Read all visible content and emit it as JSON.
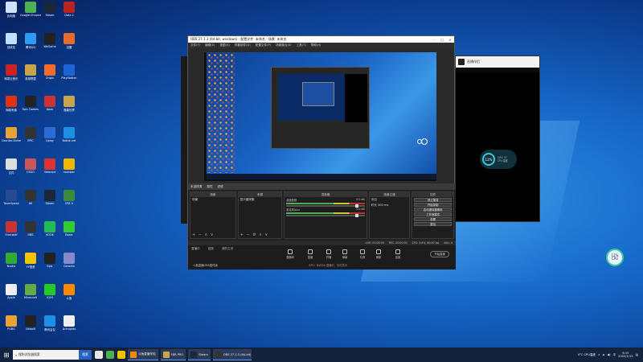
{
  "colors": {
    "desktop": "#1668c9",
    "taskbar": "#14233d",
    "obs_bg": "#2a2a2a",
    "accent": "#3ec7e0"
  },
  "desktop_icons": [
    {
      "label": "此电脑",
      "color": "#cfe3ff"
    },
    {
      "label": "Google Chrome",
      "color": "#4caf50"
    },
    {
      "label": "Steam",
      "color": "#1b2838"
    },
    {
      "label": "Dota 2",
      "color": "#b22"
    },
    {
      "label": "回收站",
      "color": "#bfe0ff"
    },
    {
      "label": "腾讯QQ",
      "color": "#2b9bf4"
    },
    {
      "label": "WeGame",
      "color": "#222"
    },
    {
      "label": "迅雷",
      "color": "#e86b2c"
    },
    {
      "label": "网易云音乐",
      "color": "#c22"
    },
    {
      "label": "英雄联盟",
      "color": "#c9a449"
    },
    {
      "label": "Origin",
      "color": "#f56c2d"
    },
    {
      "label": "PlayStation",
      "color": "#1e63d6"
    },
    {
      "label": "网易有道",
      "color": "#d31"
    },
    {
      "label": "Epic Games",
      "color": "#222"
    },
    {
      "label": "Apex",
      "color": "#c33"
    },
    {
      "label": "魔兽世界",
      "color": "#c9a449"
    },
    {
      "label": "Counter-Strike",
      "color": "#e8a338"
    },
    {
      "label": "EPIC",
      "color": "#333"
    },
    {
      "label": "Uplay",
      "color": "#2c6bd6"
    },
    {
      "label": "Battle.net",
      "color": "#1d8fe3"
    },
    {
      "label": "文件",
      "color": "#ddd"
    },
    {
      "label": "CSGO",
      "color": "#c55"
    },
    {
      "label": "Valorant",
      "color": "#d33"
    },
    {
      "label": "rockstar",
      "color": "#f2b600"
    },
    {
      "label": "TeamSpeak",
      "color": "#2a4a8f"
    },
    {
      "label": "AK",
      "color": "#333"
    },
    {
      "label": "Steam",
      "color": "#1b2838"
    },
    {
      "label": "GTA V",
      "color": "#3a8a3a"
    },
    {
      "label": "Overwolf",
      "color": "#c33"
    },
    {
      "label": "OBS",
      "color": "#333"
    },
    {
      "label": "KOOK",
      "color": "#2b5"
    },
    {
      "label": "Razer",
      "color": "#3c3"
    },
    {
      "label": "Nvidia",
      "color": "#3a3"
    },
    {
      "label": "YY语音",
      "color": "#f5c400"
    },
    {
      "label": "Epic",
      "color": "#222"
    },
    {
      "label": "Genshin",
      "color": "#88c"
    },
    {
      "label": "Apple",
      "color": "#eee"
    },
    {
      "label": "Minecraft",
      "color": "#6a4"
    },
    {
      "label": "iQIYI",
      "color": "#2c2"
    },
    {
      "label": "斗鱼",
      "color": "#f80"
    },
    {
      "label": "PUBG",
      "color": "#e8a338"
    },
    {
      "label": "Ubisoft",
      "color": "#222"
    },
    {
      "label": "腾讯会议",
      "color": "#1d8fe3"
    },
    {
      "label": "Arknights",
      "color": "#eee"
    }
  ],
  "obs": {
    "title": "OBS 27.1.3 (64-bit, windows) - 配置文件: 未命名 - 场景: 未命名",
    "menu": [
      "文件(F)",
      "编辑(E)",
      "视图(V)",
      "停靠部件(D)",
      "配置文件(P)",
      "场景集合(S)",
      "工具(T)",
      "帮助(H)"
    ],
    "sources_bar": [
      "未选择源",
      "属性",
      "滤镜"
    ],
    "docks": {
      "scenes": {
        "title": "场景",
        "item": "场景"
      },
      "sources": {
        "title": "来源",
        "item": "显示器采集"
      },
      "mixer": {
        "title": "混音器",
        "tracks": [
          {
            "name": "桌面音频",
            "db": "0.0 dB"
          },
          {
            "name": "麦克风/Aux",
            "db": "0.0 dB"
          }
        ]
      },
      "transitions": {
        "title": "场景过渡",
        "type": "淡出",
        "duration_label": "时长",
        "duration": "300 ms"
      },
      "controls": {
        "title": "控件",
        "buttons": [
          "停止推流",
          "开始录制",
          "启动虚拟摄像机",
          "工作室模式",
          "设置",
          "退出"
        ]
      }
    },
    "status": [
      "LIVE: 00:00:00",
      "REC: 00:00:00",
      "CPU: 4.6%, 60.00 fps",
      "kb/s: 0"
    ],
    "live_tabs": [
      "直播中",
      "回放",
      "我的主页"
    ],
    "live_icons": [
      "直播间",
      "直播",
      "开播",
      "弹幕",
      "礼物",
      "美颜",
      "连麦"
    ],
    "go_live": "开始直播",
    "ad_text": "斗鱼直播OBS插件版",
    "ad_text2": "GPU：NVIDIA  直播中，请勿关闭"
  },
  "cam": {
    "title": "直播伴侣",
    "gauge_value": "12%",
    "gauge_text": "GPU 37",
    "gauge_sub": "CPU温度"
  },
  "tray_gauge": {
    "value": "12%",
    "sub": "CPU"
  },
  "taskbar": {
    "search_placeholder": "搜狗浏览器搜索",
    "search_button": "搜索",
    "apps": [
      {
        "label": "斗鱼直播伴侣",
        "color": "#f80"
      },
      {
        "label": "FBR PRO",
        "color": "#c9a449"
      },
      {
        "label": "Steam",
        "color": "#1b2838"
      },
      {
        "label": "OBS 27.1.3 (64-bit)",
        "color": "#333"
      }
    ],
    "weather": "4°C",
    "weather_sub": "CPU温度",
    "time": "8:15",
    "date": "2022/1/15"
  }
}
